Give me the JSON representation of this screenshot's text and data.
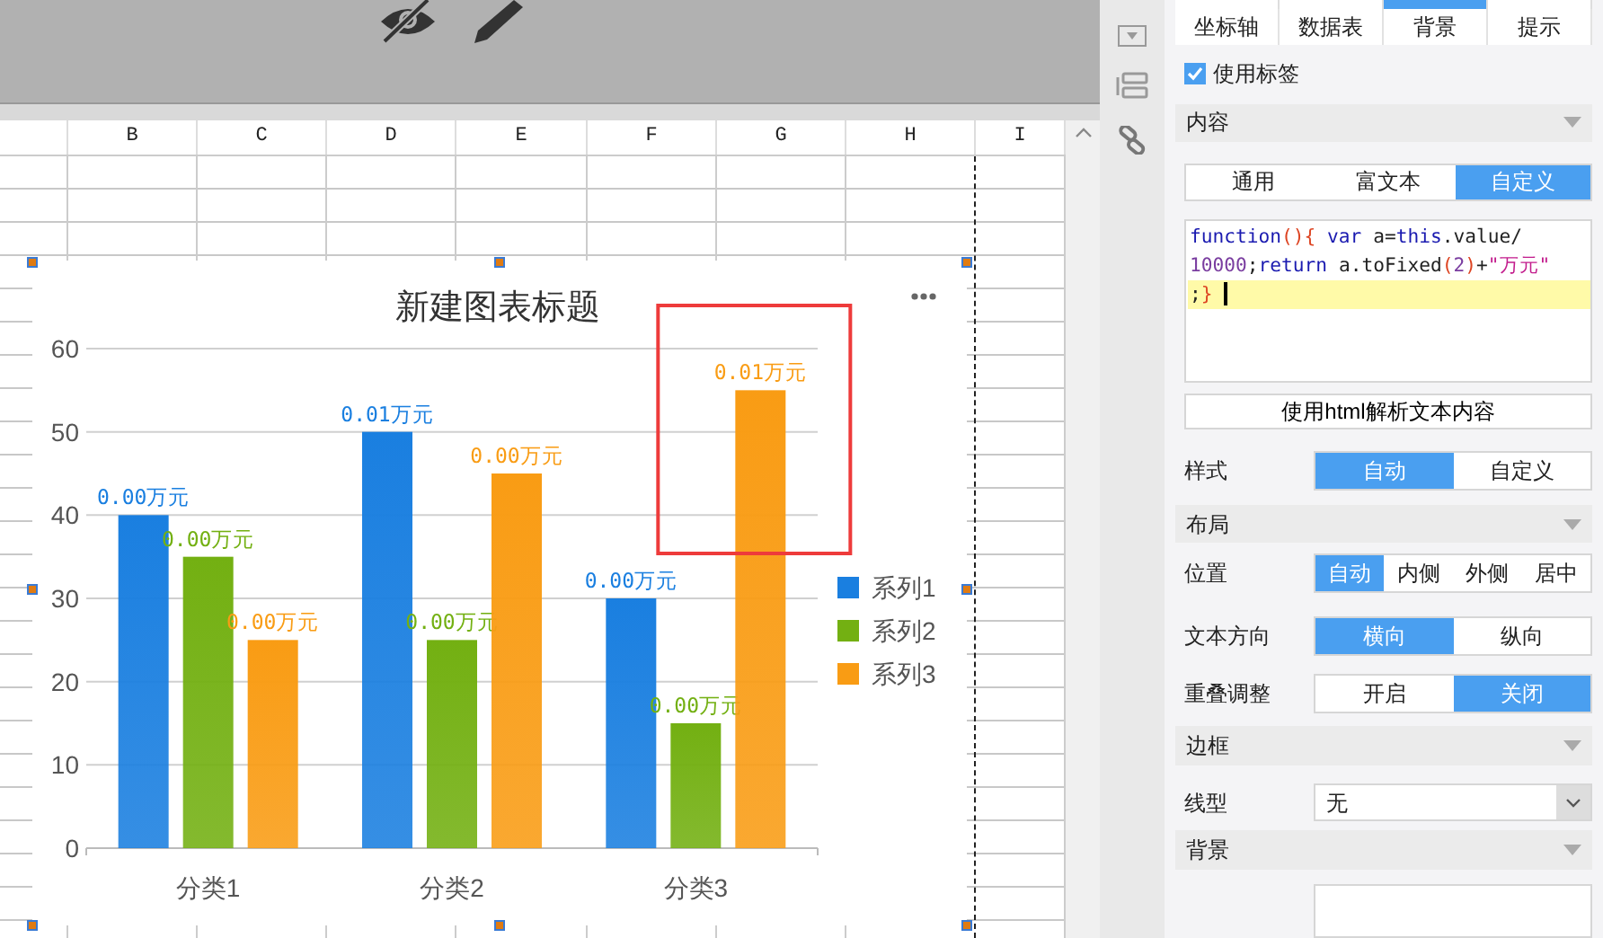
{
  "sheet": {
    "columns": [
      "B",
      "C",
      "D",
      "E",
      "F",
      "G",
      "H",
      "I"
    ]
  },
  "chart": {
    "title": "新建图表标题",
    "chart_data": {
      "type": "bar",
      "categories": [
        "分类1",
        "分类2",
        "分类3"
      ],
      "series": [
        {
          "name": "系列1",
          "color": "#1a7fe0",
          "values": [
            40,
            50,
            30
          ]
        },
        {
          "name": "系列2",
          "color": "#73b012",
          "values": [
            35,
            25,
            15
          ]
        },
        {
          "name": "系列3",
          "color": "#f99c14",
          "values": [
            25,
            45,
            55
          ]
        }
      ],
      "ylim": [
        0,
        60
      ],
      "yticks": [
        0,
        10,
        20,
        30,
        40,
        50,
        60
      ],
      "value_labels": [
        [
          "0.00万元",
          "0.01万元",
          "0.00万元"
        ],
        [
          "0.00万元",
          "0.00万元",
          "0.00万元"
        ],
        [
          "0.00万元",
          "0.00万元",
          "0.01万元"
        ]
      ],
      "grid": true,
      "legend": true
    },
    "highlight": {
      "color": "#ee3b3b"
    }
  },
  "panel": {
    "cut_tabs": [
      {
        "selected": false
      },
      {
        "selected": false
      },
      {
        "selected": true
      },
      {
        "selected": false
      }
    ],
    "tabs": [
      {
        "label": "坐标轴",
        "selected": false
      },
      {
        "label": "数据表",
        "selected": false
      },
      {
        "label": "背景",
        "selected": false
      },
      {
        "label": "提示",
        "selected": false
      }
    ],
    "use_labels": {
      "label": "使用标签",
      "checked": true
    },
    "content_section": {
      "title": "内容",
      "expanded": true,
      "modes": [
        {
          "label": "通用",
          "selected": false
        },
        {
          "label": "富文本",
          "selected": false
        },
        {
          "label": "自定义",
          "selected": true
        }
      ],
      "code_lines": [
        {
          "highlighted": false,
          "tokens": [
            {
              "t": "function",
              "color": "#1a1ab0"
            },
            {
              "t": "(){",
              "color": "#dd4422"
            },
            {
              "t": " var",
              "color": "#1a1ab0"
            },
            {
              "t": " a=",
              "color": "#222222"
            },
            {
              "t": "this",
              "color": "#1a1ab0"
            },
            {
              "t": ".value/",
              "color": "#222222"
            }
          ]
        },
        {
          "highlighted": false,
          "tokens": [
            {
              "t": "10000",
              "color": "#7a3da0"
            },
            {
              "t": ";",
              "color": "#222222"
            },
            {
              "t": "return",
              "color": "#1a1ab0"
            },
            {
              "t": " a.toFixed",
              "color": "#222222"
            },
            {
              "t": "(",
              "color": "#dd4422"
            },
            {
              "t": "2",
              "color": "#7a3da0"
            },
            {
              "t": ")",
              "color": "#dd4422"
            },
            {
              "t": "+",
              "color": "#222222"
            },
            {
              "t": "\"万元\"",
              "color": "#c21b8c"
            }
          ]
        },
        {
          "highlighted": true,
          "tokens": [
            {
              "t": ";",
              "color": "#222222"
            },
            {
              "t": "}",
              "color": "#dd4422"
            }
          ]
        }
      ],
      "html_button": "使用html解析文本内容",
      "style_label": "样式",
      "style_options": [
        {
          "label": "自动",
          "selected": true
        },
        {
          "label": "自定义",
          "selected": false
        }
      ]
    },
    "layout_section": {
      "title": "布局",
      "expanded": true,
      "rows": [
        {
          "label": "位置",
          "options": [
            {
              "label": "自动",
              "selected": true
            },
            {
              "label": "内侧",
              "selected": false
            },
            {
              "label": "外侧",
              "selected": false
            },
            {
              "label": "居中",
              "selected": false
            }
          ]
        },
        {
          "label": "文本方向",
          "options": [
            {
              "label": "横向",
              "selected": true
            },
            {
              "label": "纵向",
              "selected": false
            }
          ]
        },
        {
          "label": "重叠调整",
          "options": [
            {
              "label": "开启",
              "selected": false
            },
            {
              "label": "关闭",
              "selected": true
            }
          ]
        }
      ]
    },
    "border_section": {
      "title": "边框",
      "expanded": true,
      "line_type_label": "线型",
      "line_type_value": "无"
    },
    "background_section": {
      "title": "背景",
      "expanded": true
    }
  }
}
